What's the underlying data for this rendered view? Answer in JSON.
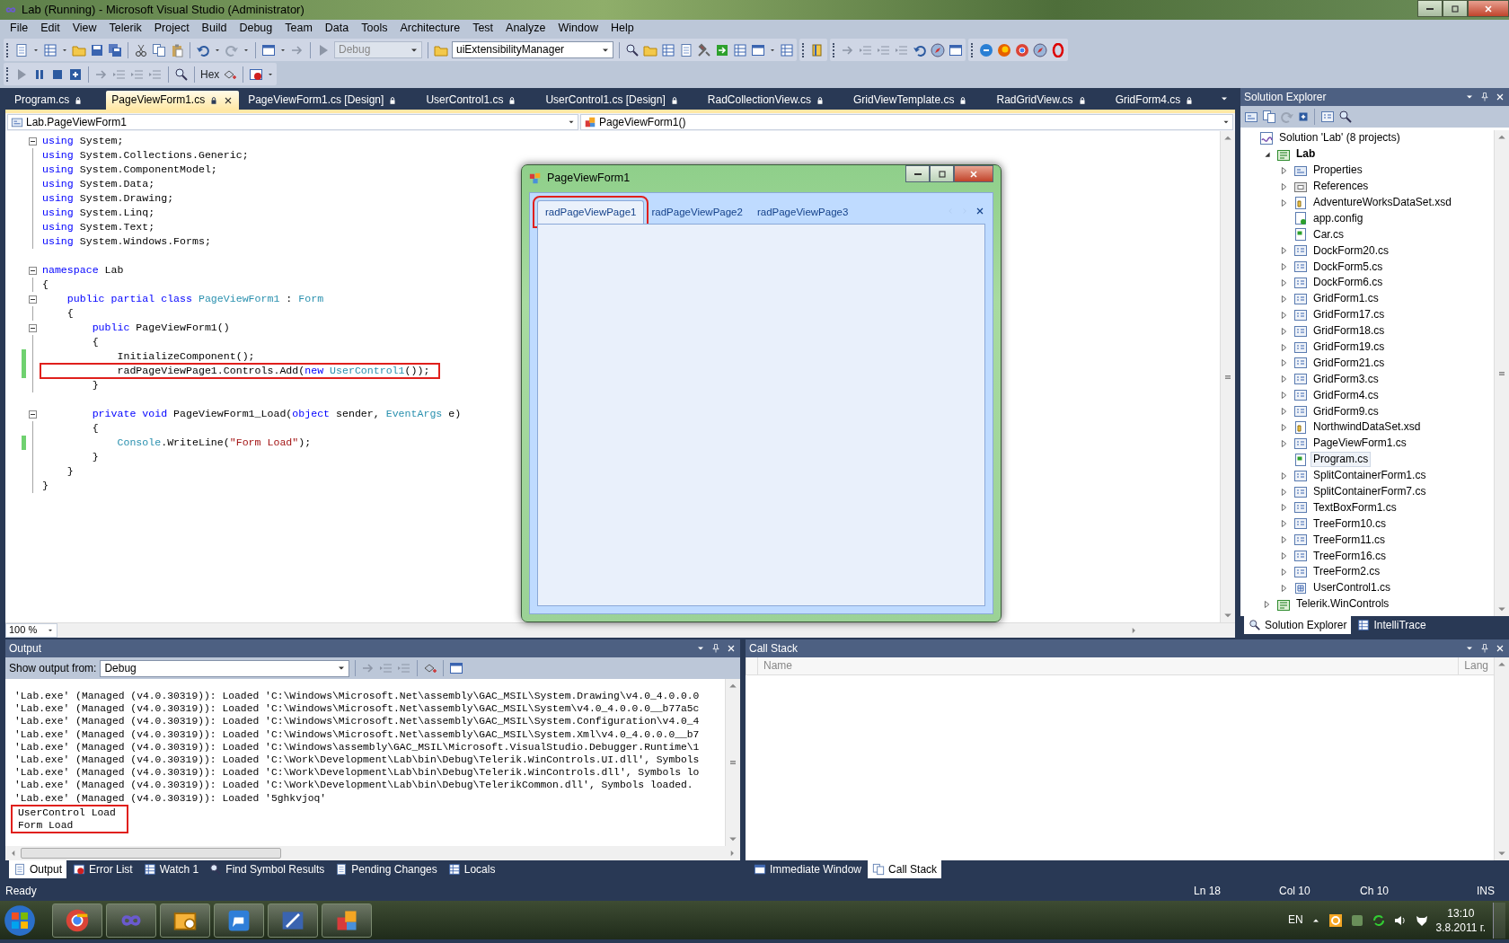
{
  "window": {
    "title": "Lab (Running) - Microsoft Visual Studio (Administrator)"
  },
  "menu": [
    "File",
    "Edit",
    "View",
    "Telerik",
    "Project",
    "Build",
    "Debug",
    "Team",
    "Data",
    "Tools",
    "Architecture",
    "Test",
    "Analyze",
    "Window",
    "Help"
  ],
  "toolbar": {
    "configuration": {
      "value": "Debug",
      "disabled": true
    },
    "find_combo": "uiExtensibilityManager",
    "hex_button": "Hex"
  },
  "document_tabs": [
    {
      "label": "Program.cs",
      "selected": false
    },
    {
      "label": "PageViewForm1.cs",
      "selected": true
    },
    {
      "label": "PageViewForm1.cs [Design]",
      "selected": false
    },
    {
      "label": "UserControl1.cs",
      "selected": false
    },
    {
      "label": "UserControl1.cs [Design]",
      "selected": false
    },
    {
      "label": "RadCollectionView.cs",
      "selected": false
    },
    {
      "label": "GridViewTemplate.cs",
      "selected": false
    },
    {
      "label": "RadGridView.cs",
      "selected": false
    },
    {
      "label": "GridForm4.cs",
      "selected": false
    }
  ],
  "editor": {
    "type_dropdown": "Lab.PageViewForm1",
    "member_dropdown": "PageViewForm1()",
    "zoom": "100 %",
    "lines": [
      {
        "kind": "code",
        "fold": true,
        "highlighted": false,
        "tokens": [
          {
            "kind": "keyword",
            "text": "using"
          },
          {
            "kind": "plain",
            "text": " System;"
          }
        ]
      },
      {
        "kind": "code",
        "fold": false,
        "highlighted": false,
        "tokens": [
          {
            "kind": "keyword",
            "text": "using"
          },
          {
            "kind": "plain",
            "text": " System.Collections.Generic;"
          }
        ]
      },
      {
        "kind": "code",
        "fold": false,
        "highlighted": false,
        "tokens": [
          {
            "kind": "keyword",
            "text": "using"
          },
          {
            "kind": "plain",
            "text": " System.ComponentModel;"
          }
        ]
      },
      {
        "kind": "code",
        "fold": false,
        "highlighted": false,
        "tokens": [
          {
            "kind": "keyword",
            "text": "using"
          },
          {
            "kind": "plain",
            "text": " System.Data;"
          }
        ]
      },
      {
        "kind": "code",
        "fold": false,
        "highlighted": false,
        "tokens": [
          {
            "kind": "keyword",
            "text": "using"
          },
          {
            "kind": "plain",
            "text": " System.Drawing;"
          }
        ]
      },
      {
        "kind": "code",
        "fold": false,
        "highlighted": false,
        "tokens": [
          {
            "kind": "keyword",
            "text": "using"
          },
          {
            "kind": "plain",
            "text": " System.Linq;"
          }
        ]
      },
      {
        "kind": "code",
        "fold": false,
        "highlighted": false,
        "tokens": [
          {
            "kind": "keyword",
            "text": "using"
          },
          {
            "kind": "plain",
            "text": " System.Text;"
          }
        ]
      },
      {
        "kind": "code",
        "fold": false,
        "highlighted": false,
        "tokens": [
          {
            "kind": "keyword",
            "text": "using"
          },
          {
            "kind": "plain",
            "text": " System.Windows.Forms;"
          }
        ]
      },
      {
        "kind": "blank"
      },
      {
        "kind": "code",
        "fold": true,
        "highlighted": false,
        "tokens": [
          {
            "kind": "keyword",
            "text": "namespace"
          },
          {
            "kind": "plain",
            "text": " Lab"
          }
        ]
      },
      {
        "kind": "code",
        "fold": false,
        "highlighted": false,
        "tokens": [
          {
            "kind": "plain",
            "text": "{"
          }
        ]
      },
      {
        "kind": "code",
        "fold": true,
        "highlighted": false,
        "tokens": [
          {
            "kind": "keyword",
            "text": "    public partial class"
          },
          {
            "kind": "type",
            "text": " PageViewForm1"
          },
          {
            "kind": "plain",
            "text": " : "
          },
          {
            "kind": "type",
            "text": "Form"
          }
        ]
      },
      {
        "kind": "code",
        "fold": false,
        "highlighted": false,
        "tokens": [
          {
            "kind": "plain",
            "text": "    {"
          }
        ]
      },
      {
        "kind": "code",
        "fold": true,
        "highlighted": false,
        "tokens": [
          {
            "kind": "keyword",
            "text": "        public"
          },
          {
            "kind": "plain",
            "text": " PageViewForm1()"
          }
        ]
      },
      {
        "kind": "code",
        "fold": false,
        "highlighted": false,
        "tokens": [
          {
            "kind": "plain",
            "text": "        {"
          }
        ]
      },
      {
        "kind": "code",
        "fold": false,
        "changed": true,
        "highlighted": false,
        "tokens": [
          {
            "kind": "plain",
            "text": "            InitializeComponent();"
          }
        ]
      },
      {
        "kind": "code",
        "fold": false,
        "changed": true,
        "highlighted": true,
        "tokens": [
          {
            "kind": "plain",
            "text": "            radPageViewPage1.Controls.Add("
          },
          {
            "kind": "keyword",
            "text": "new"
          },
          {
            "kind": "type",
            "text": " UserControl1"
          },
          {
            "kind": "plain",
            "text": "());"
          }
        ]
      },
      {
        "kind": "code",
        "fold": false,
        "highlighted": false,
        "tokens": [
          {
            "kind": "plain",
            "text": "        }"
          }
        ]
      },
      {
        "kind": "blank"
      },
      {
        "kind": "code",
        "fold": true,
        "highlighted": false,
        "tokens": [
          {
            "kind": "keyword",
            "text": "        private void"
          },
          {
            "kind": "plain",
            "text": " PageViewForm1_Load("
          },
          {
            "kind": "keyword",
            "text": "object"
          },
          {
            "kind": "plain",
            "text": " sender, "
          },
          {
            "kind": "type",
            "text": "EventArgs"
          },
          {
            "kind": "plain",
            "text": " e)"
          }
        ]
      },
      {
        "kind": "code",
        "fold": false,
        "highlighted": false,
        "tokens": [
          {
            "kind": "plain",
            "text": "        {"
          }
        ]
      },
      {
        "kind": "code",
        "fold": false,
        "changed": true,
        "highlighted": false,
        "tokens": [
          {
            "kind": "type",
            "text": "            Console"
          },
          {
            "kind": "plain",
            "text": ".WriteLine("
          },
          {
            "kind": "string",
            "text": "\"Form Load\""
          },
          {
            "kind": "plain",
            "text": ");"
          }
        ]
      },
      {
        "kind": "code",
        "fold": false,
        "highlighted": false,
        "tokens": [
          {
            "kind": "plain",
            "text": "        }"
          }
        ]
      },
      {
        "kind": "code",
        "fold": false,
        "highlighted": false,
        "tokens": [
          {
            "kind": "plain",
            "text": "    }"
          }
        ]
      },
      {
        "kind": "code",
        "fold": false,
        "highlighted": false,
        "tokens": [
          {
            "kind": "plain",
            "text": "}"
          }
        ]
      }
    ]
  },
  "form_window": {
    "title": "PageViewForm1",
    "tabs": [
      {
        "label": "radPageViewPage1",
        "selected": true,
        "highlighted": true
      },
      {
        "label": "radPageViewPage2",
        "selected": false,
        "highlighted": false
      },
      {
        "label": "radPageViewPage3",
        "selected": false,
        "highlighted": false
      }
    ]
  },
  "solution_explorer": {
    "title": "Solution Explorer",
    "tree": [
      {
        "label": "Solution 'Lab' (8 projects)",
        "kind": "solution",
        "selected": false,
        "startup": false,
        "children": [
          {
            "label": "Lab",
            "kind": "project",
            "expanded": true,
            "selected": false,
            "startup": true,
            "children": [
              {
                "label": "Properties",
                "kind": "properties",
                "expanded": false,
                "selected": false,
                "startup": false
              },
              {
                "label": "References",
                "kind": "references",
                "expanded": false,
                "selected": false,
                "startup": false
              },
              {
                "label": "AdventureWorksDataSet.xsd",
                "kind": "dataset",
                "expanded": false,
                "selected": false,
                "startup": false
              },
              {
                "label": "app.config",
                "kind": "config",
                "selected": false,
                "startup": false
              },
              {
                "label": "Car.cs",
                "kind": "code",
                "selected": false,
                "startup": false
              },
              {
                "label": "DockForm20.cs",
                "kind": "form",
                "expanded": false,
                "selected": false,
                "startup": false
              },
              {
                "label": "DockForm5.cs",
                "kind": "form",
                "expanded": false,
                "selected": false,
                "startup": false
              },
              {
                "label": "DockForm6.cs",
                "kind": "form",
                "expanded": false,
                "selected": false,
                "startup": false
              },
              {
                "label": "GridForm1.cs",
                "kind": "form",
                "expanded": false,
                "selected": false,
                "startup": false
              },
              {
                "label": "GridForm17.cs",
                "kind": "form",
                "expanded": false,
                "selected": false,
                "startup": false
              },
              {
                "label": "GridForm18.cs",
                "kind": "form",
                "expanded": false,
                "selected": false,
                "startup": false
              },
              {
                "label": "GridForm19.cs",
                "kind": "form",
                "expanded": false,
                "selected": false,
                "startup": false
              },
              {
                "label": "GridForm21.cs",
                "kind": "form",
                "expanded": false,
                "selected": false,
                "startup": false
              },
              {
                "label": "GridForm3.cs",
                "kind": "form",
                "expanded": false,
                "selected": false,
                "startup": false
              },
              {
                "label": "GridForm4.cs",
                "kind": "form",
                "expanded": false,
                "selected": false,
                "startup": false
              },
              {
                "label": "GridForm9.cs",
                "kind": "form",
                "expanded": false,
                "selected": false,
                "startup": false
              },
              {
                "label": "NorthwindDataSet.xsd",
                "kind": "dataset",
                "expanded": false,
                "selected": false,
                "startup": false
              },
              {
                "label": "PageViewForm1.cs",
                "kind": "form",
                "expanded": false,
                "selected": false,
                "startup": false
              },
              {
                "label": "Program.cs",
                "kind": "code",
                "selected": true,
                "startup": false
              },
              {
                "label": "SplitContainerForm1.cs",
                "kind": "form",
                "expanded": false,
                "selected": false,
                "startup": false
              },
              {
                "label": "SplitContainerForm7.cs",
                "kind": "form",
                "expanded": false,
                "selected": false,
                "startup": false
              },
              {
                "label": "TextBoxForm1.cs",
                "kind": "form",
                "expanded": false,
                "selected": false,
                "startup": false
              },
              {
                "label": "TreeForm10.cs",
                "kind": "form",
                "expanded": false,
                "selected": false,
                "startup": false
              },
              {
                "label": "TreeForm11.cs",
                "kind": "form",
                "expanded": false,
                "selected": false,
                "startup": false
              },
              {
                "label": "TreeForm16.cs",
                "kind": "form",
                "expanded": false,
                "selected": false,
                "startup": false
              },
              {
                "label": "TreeForm2.cs",
                "kind": "form",
                "expanded": false,
                "selected": false,
                "startup": false
              },
              {
                "label": "UserControl1.cs",
                "kind": "usercontrol",
                "expanded": false,
                "selected": false,
                "startup": false
              }
            ]
          },
          {
            "label": "Telerik.WinControls",
            "kind": "project",
            "expanded": false,
            "selected": false,
            "startup": false
          }
        ]
      }
    ],
    "tabs": [
      {
        "label": "Solution Explorer",
        "selected": true
      },
      {
        "label": "IntelliTrace",
        "selected": false
      }
    ]
  },
  "output": {
    "title": "Output",
    "source_label": "Show output from:",
    "source": "Debug",
    "messages": [
      {
        "text": "'Lab.exe' (Managed (v4.0.30319)): Loaded 'C:\\Windows\\Microsoft.Net\\assembly\\GAC_MSIL\\System.Drawing\\v4.0_4.0.0.0",
        "highlighted": false
      },
      {
        "text": "'Lab.exe' (Managed (v4.0.30319)): Loaded 'C:\\Windows\\Microsoft.Net\\assembly\\GAC_MSIL\\System\\v4.0_4.0.0.0__b77a5c",
        "highlighted": false
      },
      {
        "text": "'Lab.exe' (Managed (v4.0.30319)): Loaded 'C:\\Windows\\Microsoft.Net\\assembly\\GAC_MSIL\\System.Configuration\\v4.0_4",
        "highlighted": false
      },
      {
        "text": "'Lab.exe' (Managed (v4.0.30319)): Loaded 'C:\\Windows\\Microsoft.Net\\assembly\\GAC_MSIL\\System.Xml\\v4.0_4.0.0.0__b7",
        "highlighted": false
      },
      {
        "text": "'Lab.exe' (Managed (v4.0.30319)): Loaded 'C:\\Windows\\assembly\\GAC_MSIL\\Microsoft.VisualStudio.Debugger.Runtime\\1",
        "highlighted": false
      },
      {
        "text": "'Lab.exe' (Managed (v4.0.30319)): Loaded 'C:\\Work\\Development\\Lab\\bin\\Debug\\Telerik.WinControls.UI.dll', Symbols",
        "highlighted": false
      },
      {
        "text": "'Lab.exe' (Managed (v4.0.30319)): Loaded 'C:\\Work\\Development\\Lab\\bin\\Debug\\Telerik.WinControls.dll', Symbols lo",
        "highlighted": false
      },
      {
        "text": "'Lab.exe' (Managed (v4.0.30319)): Loaded 'C:\\Work\\Development\\Lab\\bin\\Debug\\TelerikCommon.dll', Symbols loaded.",
        "highlighted": false
      },
      {
        "text": "'Lab.exe' (Managed (v4.0.30319)): Loaded '5ghkvjoq'",
        "highlighted": false
      },
      {
        "text": "UserControl Load",
        "highlighted": true
      },
      {
        "text": "Form Load",
        "highlighted": true
      }
    ],
    "tabs": [
      {
        "label": "Output",
        "selected": true
      },
      {
        "label": "Error List",
        "selected": false
      },
      {
        "label": "Watch 1",
        "selected": false
      },
      {
        "label": "Find Symbol Results",
        "selected": false
      },
      {
        "label": "Pending Changes",
        "selected": false
      },
      {
        "label": "Locals",
        "selected": false
      }
    ]
  },
  "call_stack": {
    "title": "Call Stack",
    "columns": [
      "Name",
      "Lang"
    ],
    "tabs": [
      {
        "label": "Immediate Window",
        "selected": false
      },
      {
        "label": "Call Stack",
        "selected": true
      }
    ]
  },
  "status_bar": {
    "message": "Ready",
    "line": "Ln 18",
    "column": "Col 10",
    "char": "Ch 10",
    "mode": "INS"
  },
  "taskbar": {
    "language": "EN",
    "time": "13:10",
    "date": "3.8.2011 г."
  }
}
